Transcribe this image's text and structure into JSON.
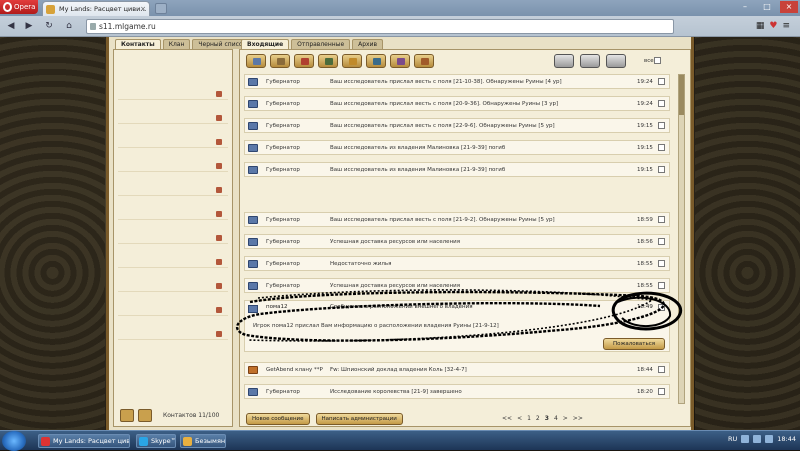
{
  "browser": {
    "menu_label": "Opera",
    "tab_title": "My Lands: Расцвет циви...",
    "url": "s11.mlgame.ru"
  },
  "game": {
    "contact_tabs": [
      "Контакты",
      "Клан",
      "Черный список"
    ],
    "mail_tabs": [
      "Входящие",
      "Отправленные",
      "Архив"
    ],
    "select_all_label": "все",
    "contacts_count": "Контактов 11/100",
    "messages": [
      {
        "sender": "Губернатор",
        "subject": "Ваш исследователь прислал весть с поля [21-10-38]. Обнаружены Руины [4 ур]",
        "time": "19:24"
      },
      {
        "sender": "Губернатор",
        "subject": "Ваш исследователь прислал весть с поля [20-9-36]. Обнаружены Руины [3 ур]",
        "time": "19:24"
      },
      {
        "sender": "Губернатор",
        "subject": "Ваш исследователь прислал весть с поля [22-9-6]. Обнаружены Руины [5 ур]",
        "time": "19:15"
      },
      {
        "sender": "Губернатор",
        "subject": "Ваш исследователь из владения Малиновка [21-9-39] погиб",
        "time": "19:15"
      },
      {
        "sender": "Губернатор",
        "subject": "Ваш исследователь из владения Малиновка [21-9-39] погиб",
        "time": "19:15"
      },
      {
        "sender": "Губернатор",
        "subject": "Ваш исследователь прислал весть с поля [21-9-2]. Обнаружены Руины [5 ур]",
        "time": "18:59"
      },
      {
        "sender": "Губернатор",
        "subject": "Успешная доставка ресурсов или населения",
        "time": "18:56"
      },
      {
        "sender": "Губернатор",
        "subject": "Недостаточно жилья",
        "time": "18:55"
      },
      {
        "sender": "Губернатор",
        "subject": "Успешная доставка ресурсов или населения",
        "time": "18:55"
      }
    ],
    "expanded": {
      "sender": "пома12",
      "subject": "Сообщение о расположении внешнего владения",
      "time": "18:49",
      "body": "Игрок пома12 прислал Вам информацию о расположении владения Руины [21-9-12]",
      "complain_label": "Пожаловаться"
    },
    "lower_messages": [
      {
        "sender": "GetAbend клану **P",
        "subject": "Fw: Шпионский доклад владения Коль [32-4-7]",
        "time": "18:44"
      },
      {
        "sender": "Губернатор",
        "subject": "Исследование королевства [21-9] завершено",
        "time": "18:20"
      }
    ],
    "new_message_label": "Новое сообщение",
    "write_admin_label": "Написать администрации",
    "pager": {
      "first": "<<",
      "prev": "<",
      "pages": [
        "1",
        "2",
        "3",
        "4"
      ],
      "current": "3",
      "next": ">",
      "last": ">>"
    }
  },
  "taskbar": {
    "items": [
      "My Lands: Расцвет циви...",
      "Skype™ - ...",
      "Безымянн..."
    ],
    "lang": "RU",
    "clock": "18:44"
  }
}
